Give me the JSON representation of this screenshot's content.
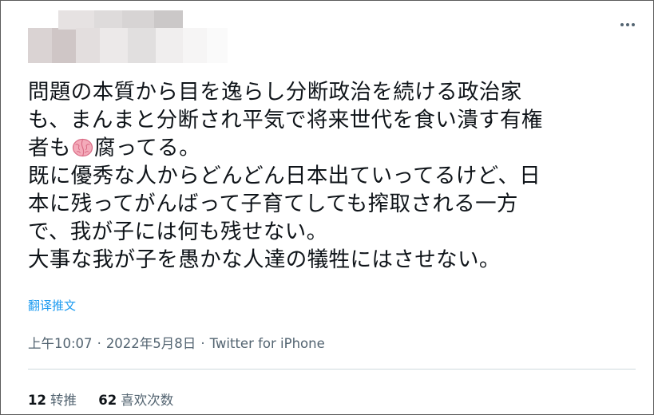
{
  "tweet": {
    "lines": [
      "問題の本質から目を逸らし分断政治を続ける政治家",
      "も、まんまと分断され平気で将来世代を食い潰す有権",
      "腐ってる。",
      "既に優秀な人からどんどん日本出ていってるけど、日",
      "本に残ってがんばって子育てしても搾取される一方",
      "で、我が子には何も残せない。",
      "大事な我が子を愚かな人達の犠牲にはさせない。"
    ],
    "line3_prefix": "者も",
    "emoji_icon": "brain-emoji-icon",
    "translate_label": "翻译推文"
  },
  "meta": {
    "time": "上午10:07",
    "date": "2022年5月8日",
    "separator": "·",
    "source": "Twitter for iPhone"
  },
  "stats": {
    "retweets_count": "12",
    "retweets_label": "转推",
    "likes_count": "62",
    "likes_label": "喜欢次数"
  },
  "colors": {
    "link": "#1d9bf0",
    "secondary_text": "#536471",
    "primary_text": "#0f1419",
    "divider": "#cfd9de"
  }
}
